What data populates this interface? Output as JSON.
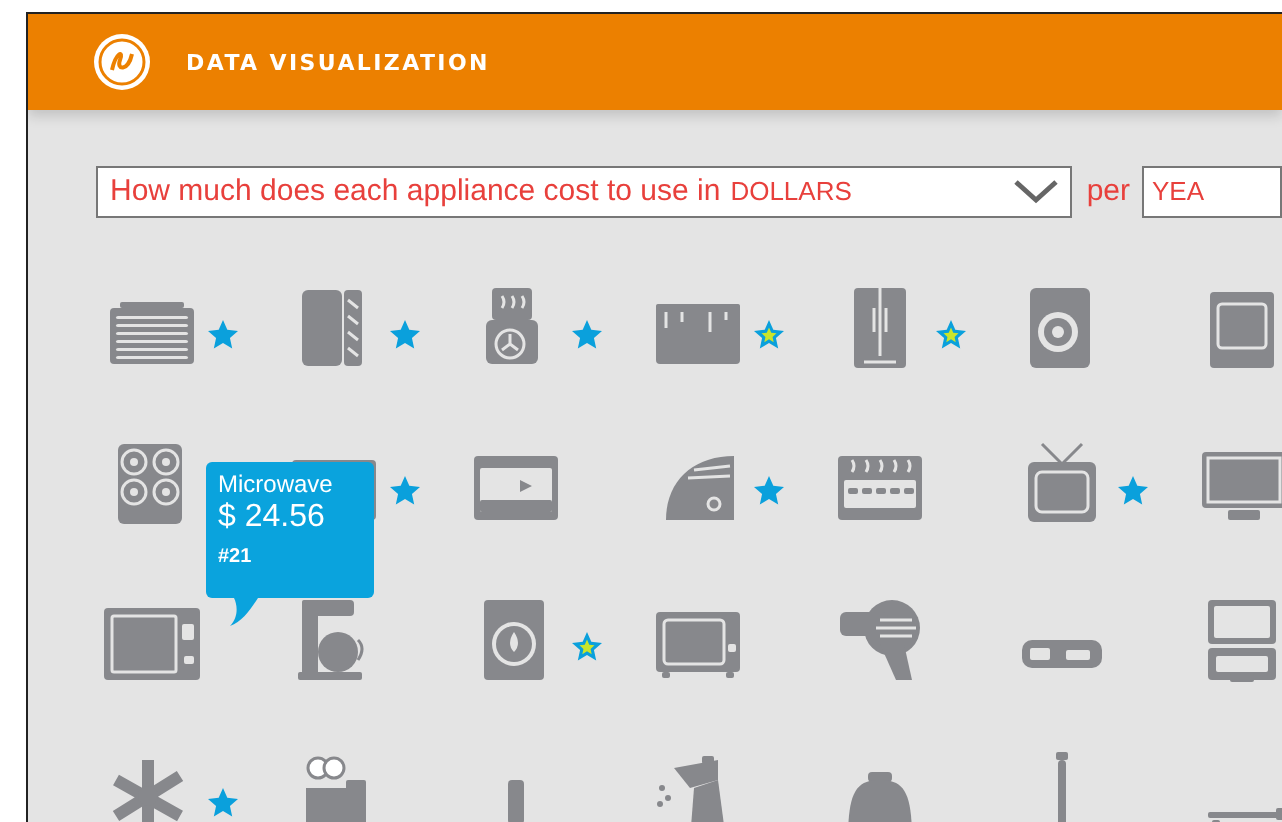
{
  "header": {
    "title": "DATA VISUALIZATION"
  },
  "query": {
    "question": "How much does each appliance cost to use in",
    "unit": "DOLLARS",
    "per": "per",
    "period": "YEA"
  },
  "appliances": [
    {
      "starred": true,
      "highlighted": false
    },
    {
      "starred": true,
      "highlighted": false
    },
    {
      "starred": true,
      "highlighted": false
    },
    {
      "starred": true,
      "highlighted": true
    },
    {
      "starred": true,
      "highlighted": true
    },
    {
      "starred": false
    },
    {
      "starred": false
    },
    {
      "starred": false
    },
    {
      "starred": true,
      "highlighted": false
    },
    {
      "starred": false
    },
    {
      "starred": true,
      "highlighted": false
    },
    {
      "starred": false
    },
    {
      "starred": true,
      "highlighted": false
    },
    {
      "starred": false
    },
    {
      "starred": false
    },
    {
      "starred": false
    },
    {
      "starred": true,
      "highlighted": true
    },
    {
      "starred": false
    },
    {
      "starred": false
    },
    {
      "starred": false
    },
    {
      "starred": false
    },
    {
      "starred": true,
      "highlighted": false
    },
    {
      "starred": false
    },
    {
      "starred": false
    },
    {
      "starred": false
    },
    {
      "starred": false
    },
    {
      "starred": false
    },
    {
      "starred": false
    }
  ],
  "tooltip": {
    "name": "Microwave",
    "cost": "$ 24.56",
    "rank": "#21"
  }
}
